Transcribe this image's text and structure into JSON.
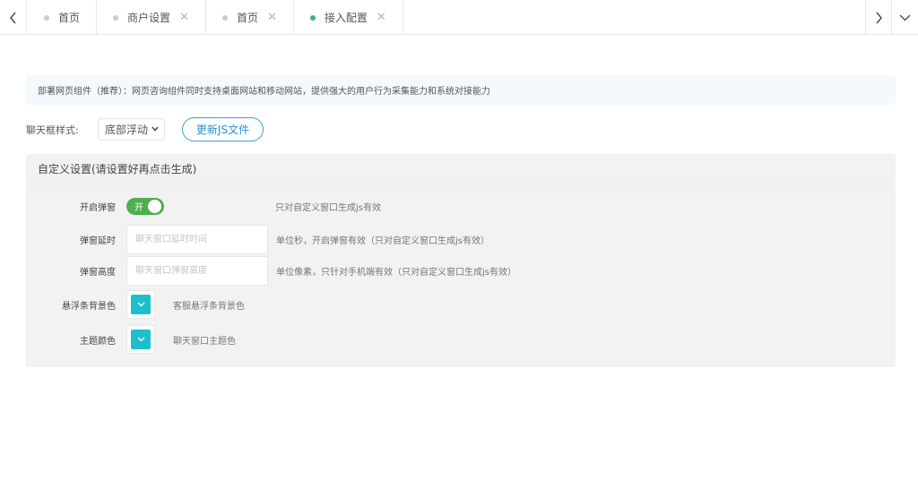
{
  "tabs": [
    {
      "label": "首页",
      "closable": false,
      "active": false
    },
    {
      "label": "商户设置",
      "closable": true,
      "active": false
    },
    {
      "label": "首页",
      "closable": true,
      "active": false
    },
    {
      "label": "接入配置",
      "closable": true,
      "active": true
    }
  ],
  "tab_close_glyph": "✕",
  "banner": {
    "text": "部署网页组件（推荐）：网页咨询组件同时支持桌面网站和移动网站，提供强大的用户行为采集能力和系统对接能力"
  },
  "chat_style": {
    "label": "聊天框样式:",
    "selected": "底部浮动",
    "update_button": "更新JS文件"
  },
  "panel": {
    "title": "自定义设置(请设置好再点击生成)",
    "popup": {
      "label": "开启弹窗",
      "switch_text": "开",
      "enabled": true,
      "hint": "只对自定义窗口生成js有效"
    },
    "delay": {
      "label": "弹窗延时",
      "placeholder": "聊天窗口延时时间",
      "value": "",
      "hint": "单位秒，开启弹窗有效（只对自定义窗口生成js有效）"
    },
    "height": {
      "label": "弹窗高度",
      "placeholder": "聊天窗口弹窗高度",
      "value": "",
      "hint": "单位像素，只针对手机端有效（只对自定义窗口生成js有效）"
    },
    "float_bg": {
      "label": "悬浮条背景色",
      "color": "#1ebfcc",
      "hint": "客服悬浮条背景色"
    },
    "theme": {
      "label": "主题颜色",
      "color": "#1ebfcc",
      "hint": "聊天窗口主题色"
    }
  },
  "colors": {
    "accent": "#3d9fd8",
    "switch_on": "#4caf50",
    "active_dot": "#3cb371",
    "swatch": "#1ebfcc"
  },
  "icons": {
    "prev": "chevron-left-icon",
    "next": "chevron-right-icon",
    "menu": "chevron-down-icon",
    "picker": "chevron-down-icon"
  }
}
